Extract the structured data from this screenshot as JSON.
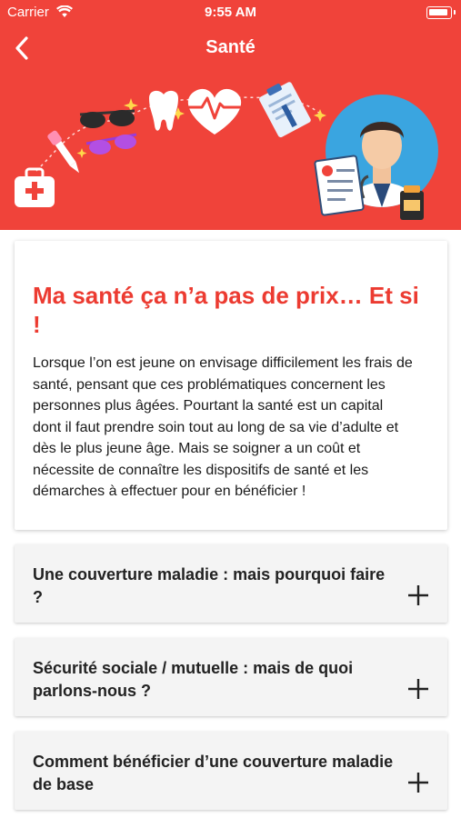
{
  "status_bar": {
    "carrier": "Carrier",
    "time": "9:55 AM",
    "icons": [
      "wifi-icon",
      "battery-icon"
    ]
  },
  "nav": {
    "title": "Santé",
    "back_icon": "chevron-left-icon"
  },
  "hero": {
    "background_color": "#f0433a",
    "illustration": [
      "first-aid-kit-icon",
      "dropper-icon",
      "sunglasses-icon",
      "tooth-icon",
      "heartbeat-icon",
      "clipboard-icon",
      "doctor-icon",
      "pill-bottle-icon"
    ]
  },
  "intro": {
    "title": "Ma santé ça n’a pas de prix… Et si !",
    "body": "Lorsque l’on est jeune on envisage difficilement les frais de santé, pensant que ces problématiques concernent les personnes plus âgées. Pourtant la santé est un capital dont il faut prendre soin tout au long de sa vie d’adulte et dès le plus jeune âge. Mais se soigner a un coût et nécessite de connaître les dispositifs de santé et les démarches à effectuer pour en bénéficier !"
  },
  "accordion": [
    {
      "label": "Une couverture maladie : mais pourquoi faire ?",
      "icon": "plus-icon"
    },
    {
      "label": "Sécurité sociale / mutuelle : mais de quoi parlons-nous ?",
      "icon": "plus-icon"
    },
    {
      "label": "Comment bénéficier d’une couverture maladie de base",
      "icon": "plus-icon"
    }
  ],
  "colors": {
    "accent": "#f0433a",
    "title_red": "#ec3b31",
    "card_grey": "#f4f4f4"
  }
}
